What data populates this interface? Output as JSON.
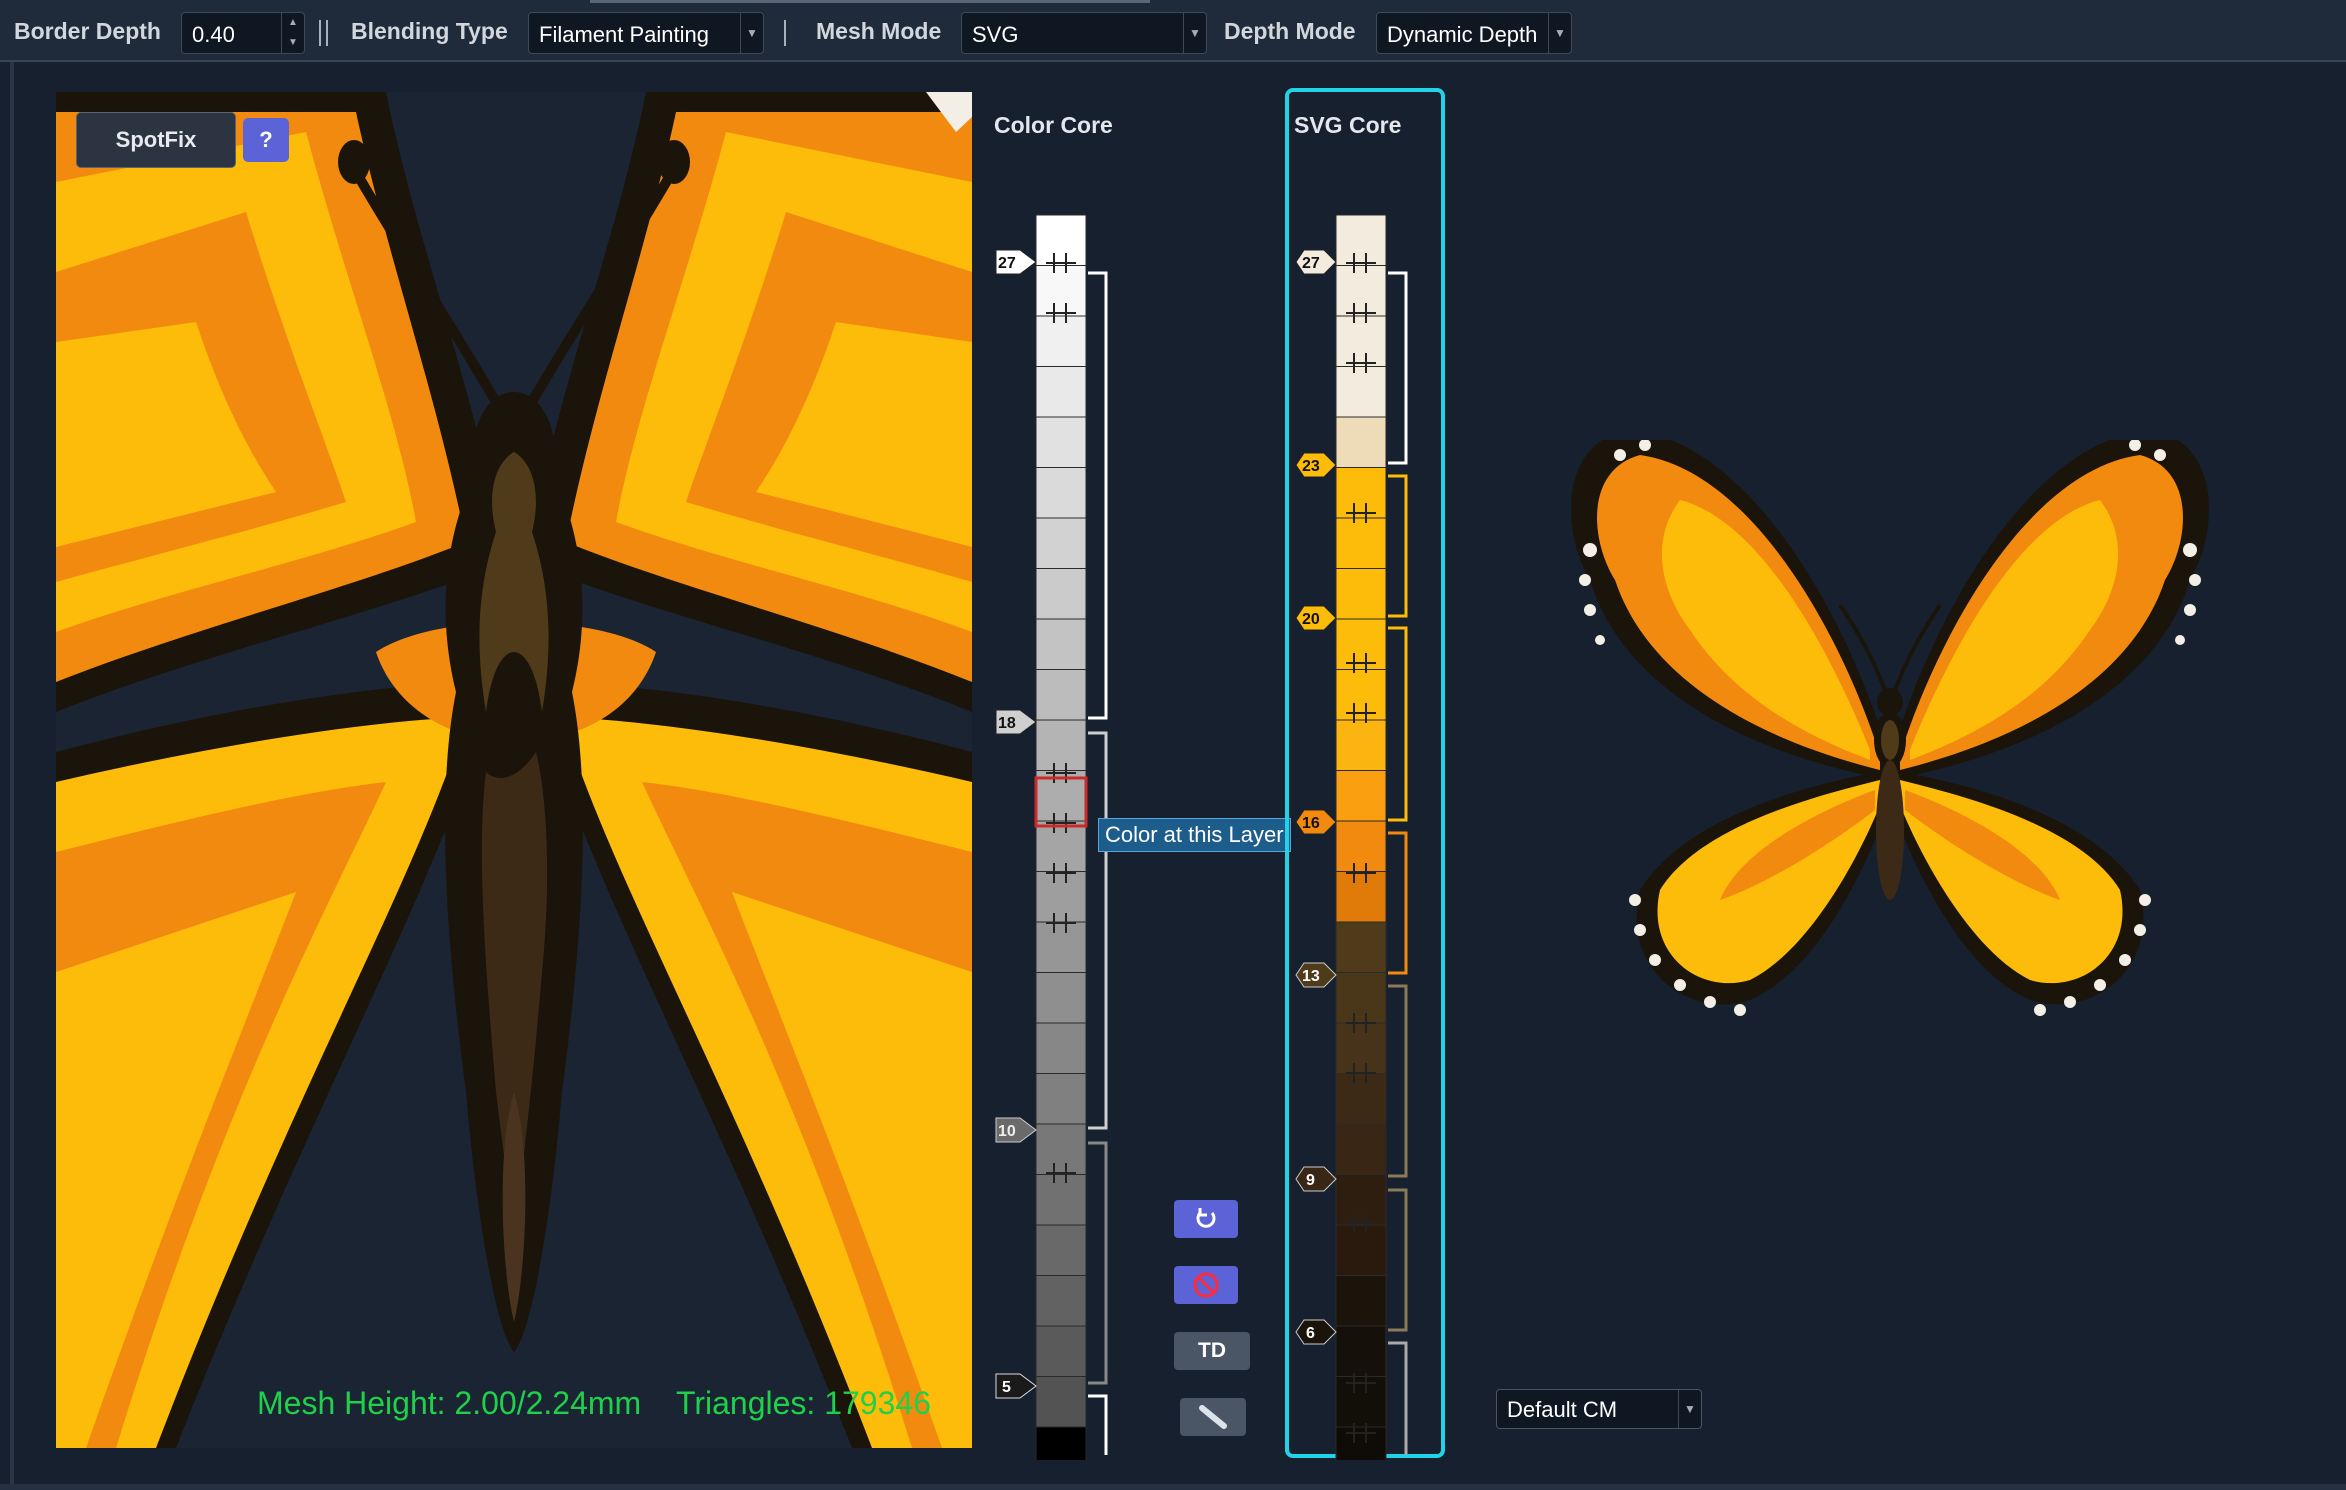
{
  "toolbar": {
    "border_depth_label": "Border Depth",
    "border_depth_value": "0.40",
    "blending_type_label": "Blending Type",
    "blending_type_value": "Filament Painting",
    "mesh_mode_label": "Mesh Mode",
    "mesh_mode_value": "SVG",
    "depth_mode_label": "Depth Mode",
    "depth_mode_value": "Dynamic Depth"
  },
  "canvas": {
    "spotfix_label": "SpotFix",
    "help_label": "?",
    "mesh_height": "Mesh Height: 2.00/2.24mm",
    "triangles": "Triangles: 179346"
  },
  "color_core": {
    "title": "Color Core",
    "markers": [
      "27",
      "18",
      "10",
      "5"
    ]
  },
  "svg_core": {
    "title": "SVG Core",
    "markers": [
      "27",
      "23",
      "20",
      "16",
      "13",
      "9",
      "6"
    ]
  },
  "tooltip": "Color at this Layer",
  "tools": {
    "td_label": "TD",
    "icons": [
      "reset-icon",
      "cancel-icon",
      "ruler-icon"
    ]
  },
  "colormap_select": "Default CM",
  "colors": {
    "accent": "#22d3e8",
    "button": "#5b63d6",
    "wing_orange": "#f38a10",
    "wing_yellow": "#fdbb0a",
    "body_dark": "#1a140b",
    "stat_green": "#1fd14a"
  }
}
